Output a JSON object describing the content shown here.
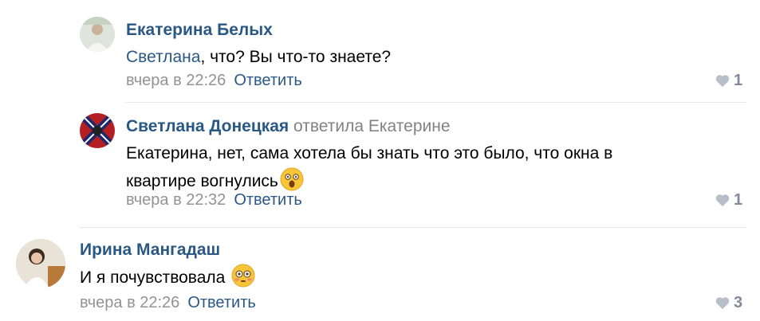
{
  "comments": [
    {
      "author": "Екатерина Белых",
      "mention": "Светлана",
      "text": ", что? Вы что-то знаете?",
      "time": "вчера в 22:26",
      "reply_label": "Ответить",
      "likes": "1"
    },
    {
      "author": "Светлана Донецкая",
      "reply_to_prefix": "ответила",
      "reply_to_name": "Екатерине",
      "text_line1": "Екатерина, нет, сама хотела бы знать что это было, что окна в",
      "text_line2": "квартире вогнулись",
      "time": "вчера в 22:32",
      "reply_label": "Ответить",
      "likes": "1"
    },
    {
      "author": "Ирина Мангадаш",
      "text": "И я почувствовала",
      "time": "вчера в 22:26",
      "reply_label": "Ответить",
      "likes": "3"
    }
  ],
  "icons": {
    "like": "heart-icon",
    "emoji_shocked": "astonished-face-emoji",
    "emoji_flushed": "flushed-face-emoji"
  },
  "colors": {
    "link": "#2a5885",
    "meta": "#939393",
    "like": "#828a99"
  }
}
